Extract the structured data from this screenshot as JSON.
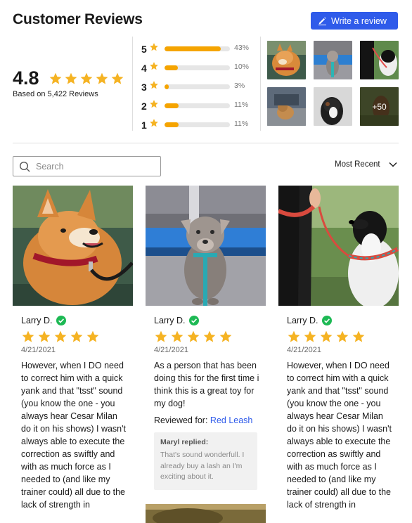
{
  "header": {
    "title": "Customer Reviews",
    "write_button": "Write a review",
    "accent": "#2f5bea"
  },
  "summary": {
    "average": "4.8",
    "stars": 5,
    "based_on": "Based on 5,422 Reviews"
  },
  "breakdown": [
    {
      "stars": "5",
      "percent": 43,
      "label": "43%"
    },
    {
      "stars": "4",
      "percent": 10,
      "label": "10%"
    },
    {
      "stars": "3",
      "percent": 3,
      "label": "3%"
    },
    {
      "stars": "2",
      "percent": 11,
      "label": "11%"
    },
    {
      "stars": "1",
      "percent": 11,
      "label": "11%"
    }
  ],
  "gallery": {
    "more_label": "+50"
  },
  "toolbar": {
    "search_placeholder": "Search",
    "sort_label": "Most Recent"
  },
  "reviews": [
    {
      "name": "Larry D.",
      "rating": 5,
      "date": "4/21/2021",
      "text": "However, when I DO need to correct him with a quick yank and that \"tsst\" sound (you know the one - you always hear Cesar Milan do it on his shows) I wasn't always able to execute the correction as swiftly and with as much force as I needed to (and like my trainer could) all due to the lack of strength in"
    },
    {
      "name": "Larry D.",
      "rating": 5,
      "date": "4/21/2021",
      "text": "As a person that has been doing this for the first time i think this is a great toy for my dog!",
      "reviewed_for_label": "Reviewed for:",
      "reviewed_for_product": "Red Leash",
      "reply": {
        "name": "Maryl replied:",
        "text": "That's sound wonderfull. I already buy a lash an I'm exciting about it."
      }
    },
    {
      "name": "Larry D.",
      "rating": 5,
      "date": "4/21/2021",
      "text": "However, when I DO need to correct him with a quick yank and that \"tsst\" sound (you know the one - you always hear Cesar Milan do it on his shows) I wasn't always able to execute the correction as swiftly and with as much force as I needed to (and like my trainer could) all due to the lack of strength in"
    }
  ],
  "colors": {
    "star": "#f5b323",
    "bar_fill": "#f5a400",
    "verified": "#1db954"
  }
}
